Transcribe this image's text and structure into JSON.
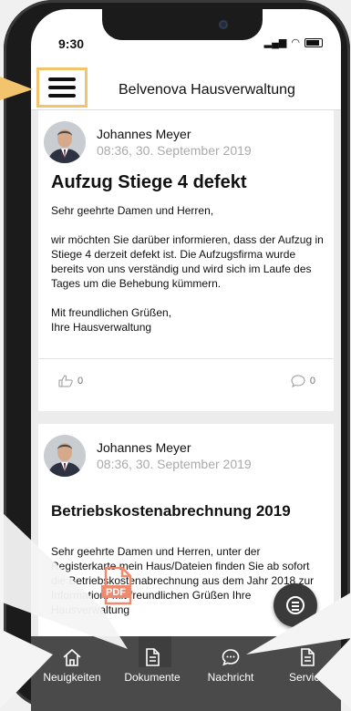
{
  "status_bar": {
    "time": "9:30",
    "signal": "..ıl"
  },
  "header": {
    "title": "Belvenova Hausverwaltung",
    "menu_icon": "hamburger-menu-icon"
  },
  "posts": [
    {
      "author": "Johannes Meyer",
      "date": "08:36, 30. September 2019",
      "title": "Aufzug Stiege 4 defekt",
      "body": "Sehr geehrte Damen und Herren,\n\nwir möchten Sie darüber informieren, dass der Aufzug in Stiege 4 derzeit defekt ist. Die Aufzugsfirma wurde bereits von uns verständig und wird sich im Laufe des Tages um die Behebung kümmern.\n\nMit freundlichen Grüßen,\nIhre Hausverwaltung",
      "likes": "0",
      "comments": "0"
    },
    {
      "author": "Johannes Meyer",
      "date": "08:36, 30. September 2019",
      "title": "Betriebskostenabrechnung 2019",
      "body": "Sehr geehrte Damen und Herren, unter der Registerkarte mein Haus/Dateien finden Sie ab sofort die Betriebskostenabrechnung aus dem Jahr 2018 zur Information. Mit freundlichen Grüßen Ihre Hausverwaltung"
    }
  ],
  "pdf_badge": "PDF",
  "tabbar": {
    "items": [
      {
        "label": "Neuigkeiten",
        "icon": "home-icon"
      },
      {
        "label": "Dokumente",
        "icon": "document-icon"
      },
      {
        "label": "Nachricht",
        "icon": "chat-bubble-icon"
      },
      {
        "label": "Service",
        "icon": "document-icon"
      }
    ]
  },
  "colors": {
    "highlight": "#f2c46d",
    "tabbar": "#4a4a4a",
    "pdf": "#f08a6e"
  }
}
